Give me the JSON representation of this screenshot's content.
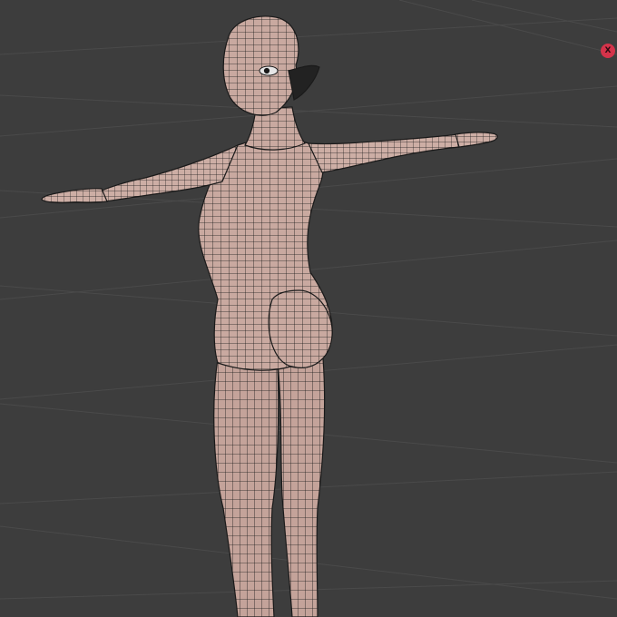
{
  "viewport": {
    "background_color": "#3d3d3d",
    "grid_color": "#4a4a4a",
    "mesh_fill_color": "#c9a9a0",
    "mesh_wire_color": "#1a1a1a"
  },
  "gizmo": {
    "axis_label": "X",
    "color": "#d4334a"
  }
}
